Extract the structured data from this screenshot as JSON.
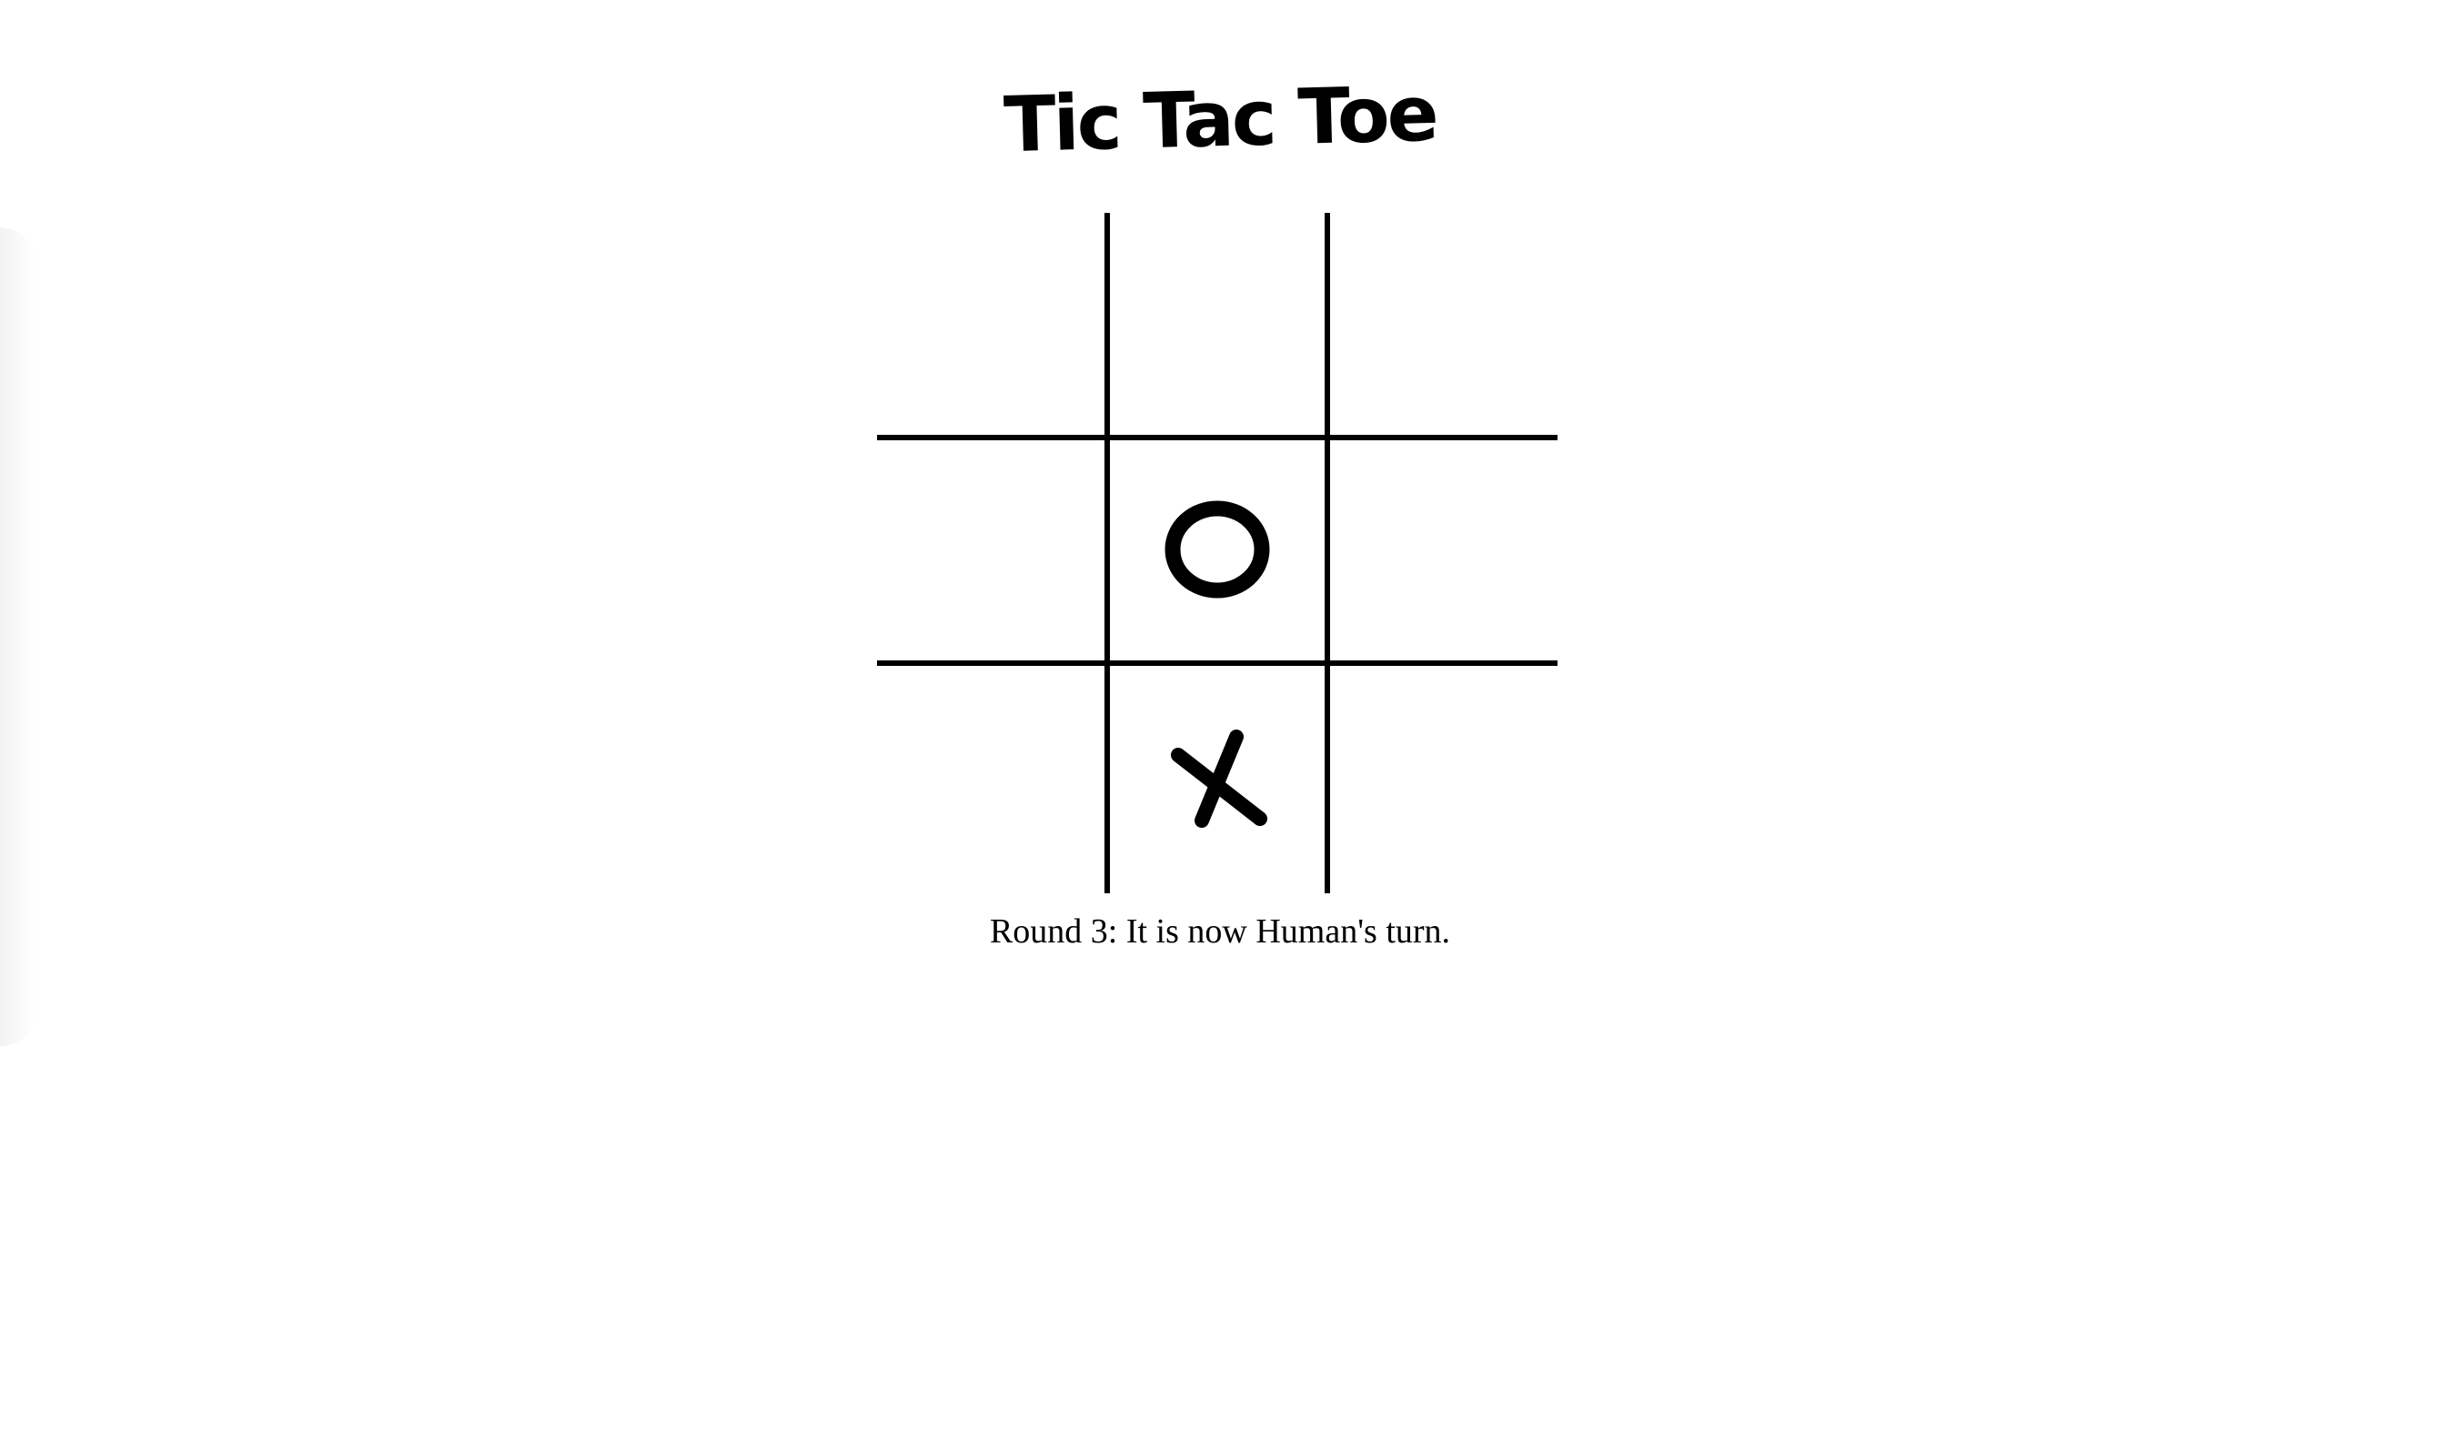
{
  "title": "Tic Tac Toe",
  "board": [
    "",
    "",
    "",
    "",
    "O",
    "",
    "",
    "X",
    ""
  ],
  "status": "Round 3: It is now Human's turn.",
  "colors": {
    "background": "#ffffff",
    "ink": "#000000"
  }
}
